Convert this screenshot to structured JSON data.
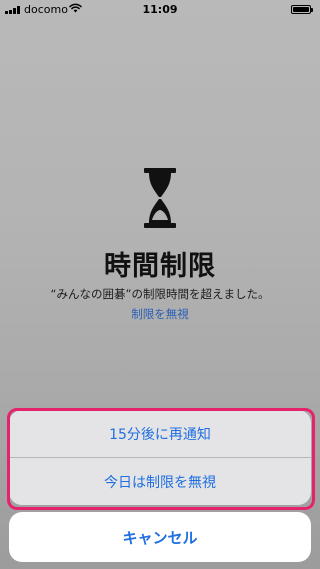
{
  "status_bar": {
    "carrier": "docomo",
    "time": "11:09"
  },
  "screen_time": {
    "title": "時間制限",
    "message": "“みんなの囲碁”の制限時間を超えました。",
    "ignore_link": "制限を無視"
  },
  "action_sheet": {
    "remind_label": "15分後に再通知",
    "ignore_today_label": "今日は制限を無視",
    "cancel_label": "キャンセル"
  },
  "colors": {
    "accent_blue": "#1f6fe0",
    "link_blue": "#2a60b5",
    "highlight_pink": "#e5236d"
  },
  "icons": {
    "hourglass": "hourglass-icon",
    "wifi": "wifi-icon",
    "battery": "battery-icon",
    "signal": "signal-icon"
  }
}
